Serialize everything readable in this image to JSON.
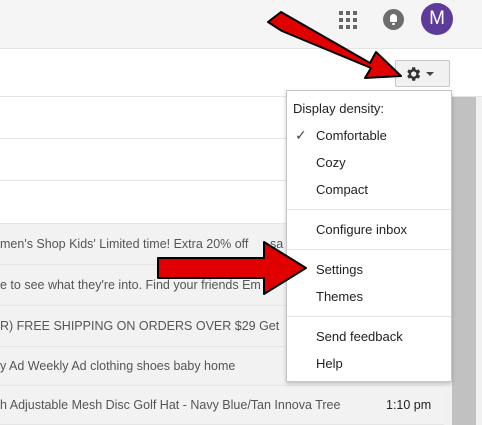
{
  "header": {
    "avatar_letter": "M"
  },
  "rows": [
    {
      "snippet": "",
      "time": ""
    },
    {
      "snippet": "",
      "time": ""
    },
    {
      "snippet": "",
      "time": ""
    },
    {
      "snippet": "men's Shop Kids' Limited time! Extra 20% off",
      "suffix": "sa",
      "time": ""
    },
    {
      "snippet": "e to see what they're into. Find your friends Em",
      "time": ""
    },
    {
      "snippet": "R) FREE SHIPPING ON ORDERS OVER $29 Get",
      "time": ""
    },
    {
      "snippet": "y Ad Weekly Ad clothing shoes baby home",
      "time": ""
    },
    {
      "snippet": "h Adjustable Mesh Disc Golf Hat - Navy Blue/Tan Innova Tree",
      "time": "1:10 pm"
    }
  ],
  "menu": {
    "heading": "Display density:",
    "density_options": [
      "Comfortable",
      "Cozy",
      "Compact"
    ],
    "selected_density": "Comfortable",
    "configure_inbox": "Configure inbox",
    "settings": "Settings",
    "themes": "Themes",
    "send_feedback": "Send feedback",
    "help": "Help"
  },
  "colors": {
    "avatar_bg": "#5e3a9a",
    "arrow_red": "#e00000"
  },
  "icons": [
    "apps-icon",
    "notifications-icon",
    "gear-icon",
    "chevron-down-icon",
    "checkmark-icon"
  ]
}
